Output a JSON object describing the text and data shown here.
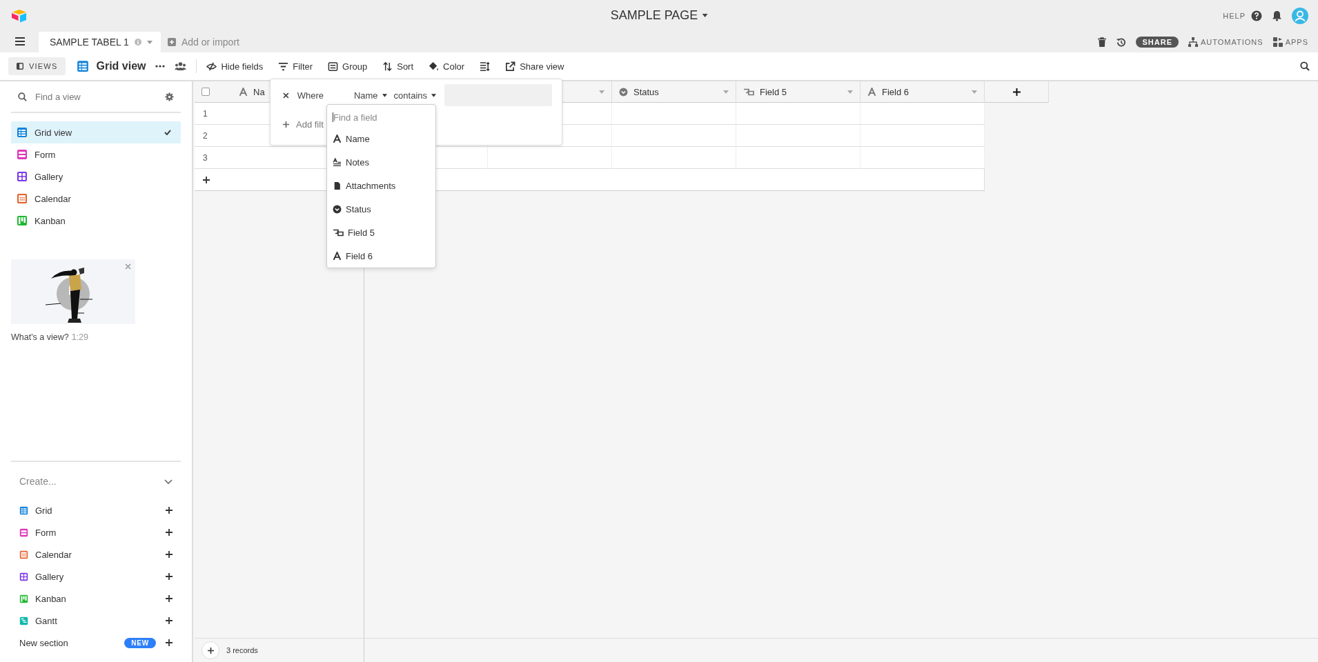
{
  "app": {
    "title": "SAMPLE PAGE",
    "help": "HELP"
  },
  "tabs": [
    {
      "label": "SAMPLE TABEL 1",
      "selected": true
    }
  ],
  "add_table": "Add or import",
  "actions": {
    "share": "SHARE",
    "automations": "AUTOMATIONS",
    "apps": "APPS"
  },
  "toolbar": {
    "views_toggle": "VIEWS",
    "view_name": "Grid view",
    "tools": [
      {
        "kind": "hide",
        "label": "Hide fields"
      },
      {
        "kind": "filter",
        "label": "Filter"
      },
      {
        "kind": "group",
        "label": "Group"
      },
      {
        "kind": "sort",
        "label": "Sort"
      },
      {
        "kind": "color",
        "label": "Color"
      },
      {
        "kind": "rowheight"
      },
      {
        "kind": "share",
        "label": "Share view"
      }
    ]
  },
  "sidebar": {
    "search": {
      "placeholder": "Find a view"
    },
    "views": [
      {
        "name": "Grid view",
        "kind": "grid",
        "color": "#1283da",
        "selected": true
      },
      {
        "name": "Form",
        "kind": "form",
        "color": "#dd39b8",
        "selected": false
      },
      {
        "name": "Gallery",
        "kind": "gallery",
        "color": "#7c39ed",
        "selected": false
      },
      {
        "name": "Calendar",
        "kind": "calendar",
        "color": "#e3632f",
        "selected": false
      },
      {
        "name": "Kanban",
        "kind": "kanban",
        "color": "#20b933",
        "selected": false
      }
    ],
    "video": {
      "kind": "picture",
      "caption": "What's a view?",
      "duration": "1:29"
    },
    "create": {
      "title": "Create...",
      "items": [
        {
          "name": "Grid",
          "kind": "grid",
          "color": "#1283da"
        },
        {
          "name": "Form",
          "kind": "form",
          "color": "#dd39b8"
        },
        {
          "name": "Calendar",
          "kind": "calendar",
          "color": "#e3632f"
        },
        {
          "name": "Gallery",
          "kind": "gallery",
          "color": "#7c39ed"
        },
        {
          "name": "Kanban",
          "kind": "kanban",
          "color": "#20b933"
        },
        {
          "name": "Gantt",
          "kind": "gantt",
          "color": "#0fb8a8"
        }
      ],
      "new_section": {
        "label": "New section",
        "badge": "NEW"
      }
    }
  },
  "grid": {
    "select_all_checked": false,
    "columns": [
      {
        "label": "Na",
        "kind": "text"
      },
      {
        "kind": "covered"
      },
      {
        "kind": "covered"
      },
      {
        "label": "Status",
        "kind": "select"
      },
      {
        "label": "Field 5",
        "kind": "link"
      },
      {
        "label": "Field 6",
        "kind": "text"
      }
    ],
    "rows": [
      "1",
      "2",
      "3"
    ],
    "footer": "3 records"
  },
  "filter": {
    "where": "Where",
    "field": "Name",
    "operator": "contains",
    "add": "Add filt"
  },
  "field_picker": {
    "placeholder": "Find a field",
    "fields": [
      {
        "label": "Name",
        "kind": "text"
      },
      {
        "label": "Notes",
        "kind": "longtext"
      },
      {
        "label": "Attachments",
        "kind": "attachment"
      },
      {
        "label": "Status",
        "kind": "select"
      },
      {
        "label": "Field 5",
        "kind": "link"
      },
      {
        "label": "Field 6",
        "kind": "text"
      }
    ]
  }
}
